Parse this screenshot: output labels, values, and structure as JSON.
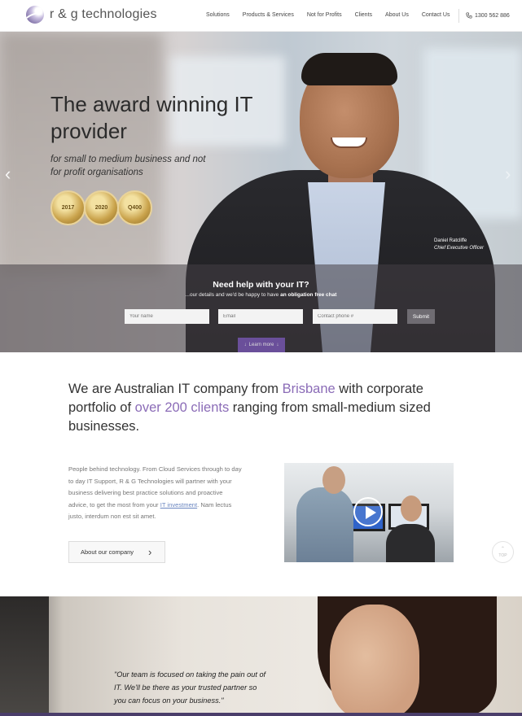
{
  "brand": {
    "name": "r & g technologies"
  },
  "nav": {
    "items": [
      "Solutions",
      "Products & Services",
      "Not for Profits",
      "Clients",
      "About Us",
      "Contact Us"
    ],
    "phone": "1300 562 886"
  },
  "hero": {
    "title": "The award winning IT provider",
    "subtitle": "for small to medium business and not for profit organisations",
    "awards": [
      "2017",
      "2020",
      "Q400"
    ],
    "caption_name": "Daniel Ratcliffe",
    "caption_role": "Chief Executive Officer"
  },
  "help_form": {
    "title": "Need help with your IT?",
    "sub_prefix": "...our details and we'd be happy to have ",
    "sub_bold": "an obligation free chat",
    "name_placeholder": "Your name",
    "email_placeholder": "Email",
    "phone_placeholder": "Contact phone #",
    "submit_label": "Submit",
    "learn_more_label": "Learn more"
  },
  "statement": {
    "part1": "We are Australian IT company from ",
    "highlight1": "Brisbane",
    "part2": " with corporate portfolio of ",
    "highlight2": "over 200 clients",
    "part3": " ranging from small-medium sized businesses."
  },
  "about": {
    "text_before_link": "People behind technology. From Cloud Services through to day to day IT Support, R & G Technologies will partner with your business delivering best practice solutions and proactive advice, to get the most from your ",
    "link_text": "IT investment",
    "text_after_link": ". Nam lectus justo, interdum non est sit amet.",
    "button_label": "About our company"
  },
  "top_button_label": "TOP",
  "testimonial": {
    "quote": "\"Our team is focused on taking the pain out of IT. We'll be there as your trusted partner so you can focus on your business.\""
  },
  "colors": {
    "accent": "#8b6cb7",
    "button_purple": "#6a4f9a"
  }
}
